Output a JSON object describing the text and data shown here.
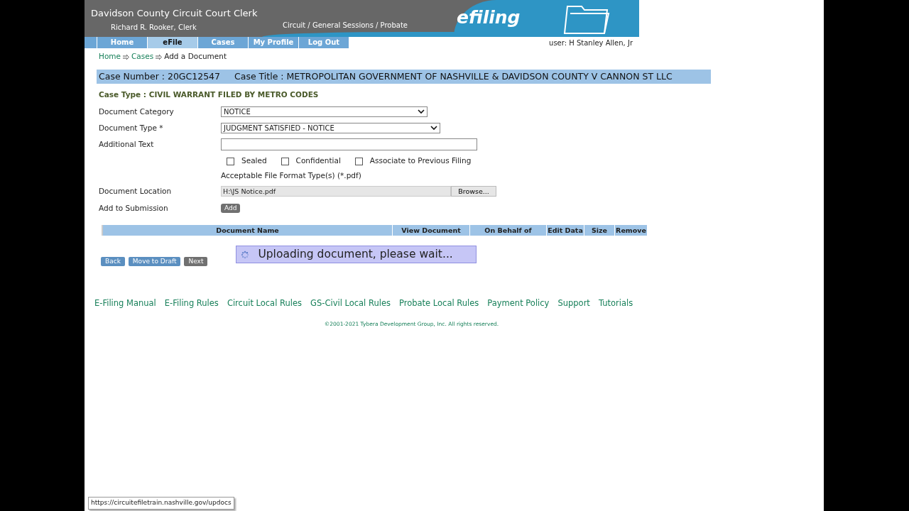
{
  "header": {
    "title": "Davidson County Circuit Court Clerk",
    "subtitle": "Richard R. Rooker, Clerk",
    "tagline": "Circuit / General Sessions / Probate",
    "brand": "efiling"
  },
  "nav": [
    {
      "label": "Home",
      "selected": false
    },
    {
      "label": "eFile",
      "selected": true
    },
    {
      "label": "Cases",
      "selected": false
    },
    {
      "label": "My Profile",
      "selected": false
    },
    {
      "label": "Log Out",
      "selected": false
    }
  ],
  "user": "user: H Stanley Allen, Jr",
  "breadcrumb": [
    {
      "label": "Home",
      "kind": "link"
    },
    {
      "label": "Cases",
      "kind": "link"
    },
    {
      "label": "Add a Document",
      "kind": "current"
    }
  ],
  "case_number": "Case Number : 20GC12547",
  "case_title": "Case Title : METROPOLITAN GOVERNMENT OF NASHVILLE & DAVIDSON COUNTY V CANNON ST LLC",
  "case_type": "Case Type : CIVIL WARRANT FILED BY METRO CODES",
  "fields": [
    {
      "kind": "select",
      "label": "Document Category",
      "value": "NOTICE"
    },
    {
      "kind": "select",
      "label": "Document Type *",
      "value": "JUDGMENT SATISFIED - NOTICE"
    },
    {
      "kind": "text",
      "label": "Additional Text"
    }
  ],
  "checkboxes": [
    {
      "label": "Sealed",
      "checked": false
    },
    {
      "label": "Confidential",
      "checked": false
    },
    {
      "label": "Associate to Previous Filing",
      "checked": false
    }
  ],
  "format_note": "Acceptable File Format Type(s) (*.pdf)",
  "location": {
    "label": "Document Location",
    "value": "H:\\JS Notice.pdf",
    "browse": "Browse..."
  },
  "add": {
    "label": "Add to Submission",
    "button": "Add"
  },
  "table": {
    "columns": [
      "Document Name",
      "View Document",
      "On Behalf of",
      "Edit Data",
      "Size",
      "Remove"
    ]
  },
  "buttons": [
    {
      "label": "Back",
      "disabled": false
    },
    {
      "label": "Move to Draft",
      "disabled": false
    },
    {
      "label": "Next",
      "disabled": true
    }
  ],
  "loading": "Uploading document, please wait...",
  "footer_links": [
    "E-Filing Manual",
    "E-Filing Rules",
    "Circuit Local Rules",
    "GS-Civil Local Rules",
    "Probate Local Rules",
    "Payment Policy",
    "Support",
    "Tutorials"
  ],
  "copyright": "©2001-2021 Tybera Development Group, Inc. All rights reserved.",
  "status_url": "https://circuitefiletrain.nashville.gov/updocs"
}
